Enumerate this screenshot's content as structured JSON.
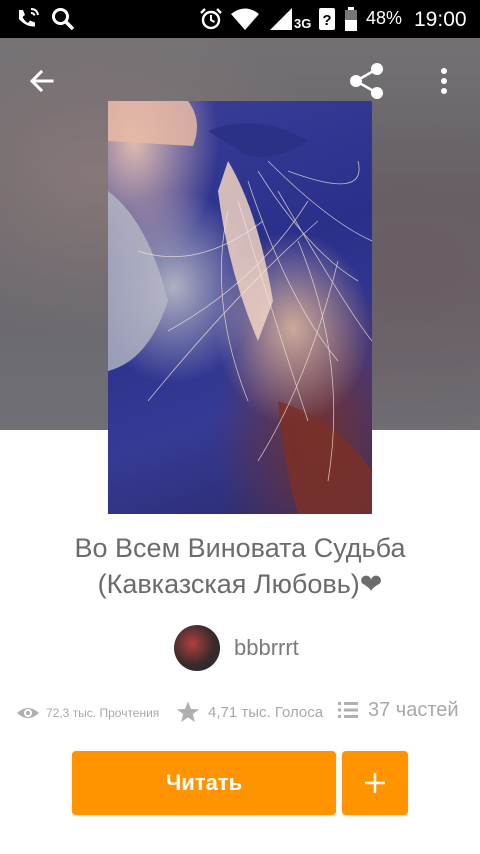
{
  "status_bar": {
    "battery": "48%",
    "time": "19:00",
    "network": "3G",
    "icons": [
      "phone-wifi-icon",
      "search-icon",
      "alarm-icon",
      "wifi-icon",
      "signal-icon",
      "unknown-sim-icon",
      "battery-icon"
    ]
  },
  "toolbar": {
    "icons": [
      "back-arrow-icon",
      "share-icon",
      "more-vert-icon"
    ]
  },
  "story": {
    "title_line1": "Во Всем Виновата Судьба",
    "title_line2": "(Кавказская Любовь)❤",
    "author": "bbbrrrt"
  },
  "stats": {
    "reads": "72,3 тыс. Прочтения",
    "votes": "4,71 тыс. Голоса",
    "parts": "37 частей",
    "icons": [
      "eye-icon",
      "star-icon",
      "list-icon"
    ]
  },
  "actions": {
    "read_label": "Читать",
    "add_label": "+",
    "accent_color": "#ff9400"
  }
}
